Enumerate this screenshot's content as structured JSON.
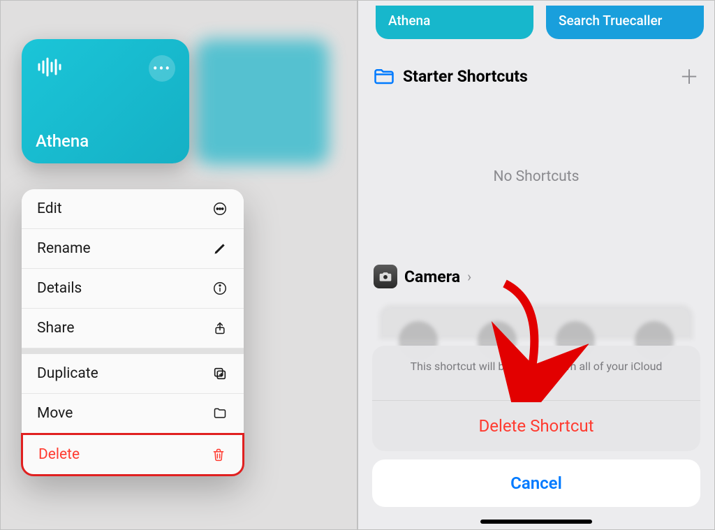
{
  "left": {
    "card": {
      "name": "Athena"
    },
    "menu": {
      "edit": "Edit",
      "rename": "Rename",
      "details": "Details",
      "share": "Share",
      "duplicate": "Duplicate",
      "move": "Move",
      "delete": "Delete"
    }
  },
  "right": {
    "tiles": {
      "athena": "Athena",
      "truecaller": "Search Truecaller"
    },
    "folder": "Starter Shortcuts",
    "empty": "No Shortcuts",
    "camera": "Camera",
    "sheet": {
      "message": "This shortcut will be deleted from all of your iCloud devices.",
      "delete": "Delete Shortcut",
      "cancel": "Cancel"
    }
  }
}
